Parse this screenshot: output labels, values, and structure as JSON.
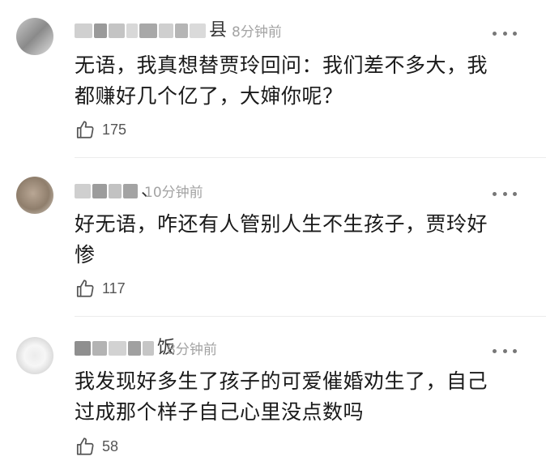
{
  "comments": [
    {
      "username_visible": "县",
      "time": "8分钟前",
      "text_lines": [
        "无语，我真想替贾玲回问：我们差不多大，我",
        "都赚好几个亿了，大婶你呢？"
      ],
      "likes": "175"
    },
    {
      "username_visible": "、",
      "time": "10分钟前",
      "text_lines": [
        "好无语，咋还有人管别人生不生孩子，贾玲好",
        "惨"
      ],
      "likes": "117"
    },
    {
      "username_visible": "饭",
      "time": "8分钟前",
      "text_lines": [
        "我发现好多生了孩子的可爱催婚劝生了，自己",
        "过成那个样子自己心里没点数吗"
      ],
      "likes": "58"
    }
  ],
  "icons": {
    "like": "thumbs-up-icon",
    "more": "more-dots-icon"
  },
  "colors": {
    "time": "#a3a3a3",
    "text": "#1a1a1a",
    "divider": "#ececec"
  }
}
